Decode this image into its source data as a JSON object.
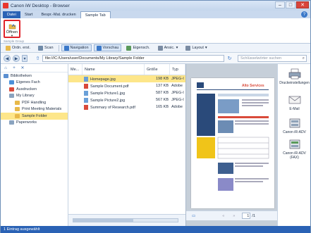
{
  "window": {
    "title": "Canon iW Desktop - Browser"
  },
  "ribbon_tabs": [
    {
      "label": "Datei"
    },
    {
      "label": "Start"
    },
    {
      "label": "Bespr.-Mat. drucken"
    },
    {
      "label": "Sample Tab"
    }
  ],
  "ribbon": {
    "open_label": "Öffnen",
    "group_label": "Sample Group"
  },
  "toolbar": {
    "buttons": [
      {
        "label": "Ordn. erst."
      },
      {
        "label": "Scan"
      },
      {
        "label": "Navigation"
      },
      {
        "label": "Vorschau"
      },
      {
        "label": "Eigensch."
      },
      {
        "label": "Ansic."
      },
      {
        "label": "Layout"
      }
    ]
  },
  "address": {
    "path": "file:///C:/Users/user/Documents/My Library/Sample Folder",
    "search_placeholder": "Schlüsselwörter suchen"
  },
  "tree": [
    {
      "label": "Bibliotheken",
      "indent": 0,
      "color": "#5b8fd1"
    },
    {
      "label": "Eigenes Fach",
      "indent": 1,
      "color": "#4a90d9"
    },
    {
      "label": "Ausdrucken",
      "indent": 1,
      "color": "#d94a3a"
    },
    {
      "label": "My Library",
      "indent": 1,
      "color": "#8aa3bf"
    },
    {
      "label": "PDF Handling",
      "indent": 2,
      "color": "#e8b94a"
    },
    {
      "label": "Print Meeting Materials",
      "indent": 2,
      "color": "#e8b94a"
    },
    {
      "label": "Sample Folder",
      "indent": 2,
      "color": "#e8b94a",
      "selected": true
    },
    {
      "label": "Paperworks",
      "indent": 1,
      "color": "#8aa3bf"
    }
  ],
  "file_list": {
    "headers": {
      "mark": "Me...",
      "name": "Name",
      "size": "Größe",
      "type": "Typ"
    },
    "rows": [
      {
        "name": "Homepage.jpg",
        "size": "198 KB",
        "type": "JPEG-I",
        "icon": "#6aa0d8",
        "selected": true
      },
      {
        "name": "Sample Document.pdf",
        "size": "137 KB",
        "type": "Adobe",
        "icon": "#d94a3a"
      },
      {
        "name": "Sample Picture1.jpg",
        "size": "587 KB",
        "type": "JPEG-I",
        "icon": "#6aa0d8"
      },
      {
        "name": "Sample Picture2.jpg",
        "size": "567 KB",
        "type": "JPEG-I",
        "icon": "#6aa0d8"
      },
      {
        "name": "Summary of Research.pdf",
        "size": "165 KB",
        "type": "Adobe",
        "icon": "#d94a3a"
      }
    ]
  },
  "preview": {
    "page_heading": "Alto Services",
    "page_number": "1",
    "page_total": "/1"
  },
  "right_panel": [
    {
      "label": "Druckeinstellungen"
    },
    {
      "label": "E-Mail"
    },
    {
      "label": "Canon iR-ADV"
    },
    {
      "label": "Canon iR-ADV (FAX)"
    }
  ],
  "status": {
    "text": "1 Eintrag ausgewählt"
  },
  "colors": {
    "accent": "#2a62b5",
    "selection": "#fde68a",
    "highlight_border": "#e0222a"
  }
}
